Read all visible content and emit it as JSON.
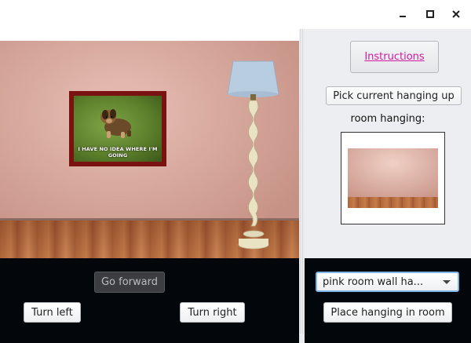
{
  "window": {
    "controls": {
      "minimize": "minimize-icon",
      "maximize": "maximize-icon",
      "close": "close-icon"
    }
  },
  "scene": {
    "picture_caption": "I HAVE NO IDEA WHERE I'M GOING",
    "wall_color": "#d9aba0",
    "floor_color": "#b06a3c",
    "frame_color": "#7a1212"
  },
  "sidebar": {
    "instructions_label": "Instructions",
    "pick_label": "Pick current hanging up",
    "hanging_label": "room hanging:",
    "link_color": "#d11aa0"
  },
  "controls": {
    "go_forward_label": "Go forward",
    "turn_left_label": "Turn left",
    "turn_right_label": "Turn right",
    "hanging_select_value": "pink room wall ha...",
    "place_label": "Place hanging in room"
  }
}
